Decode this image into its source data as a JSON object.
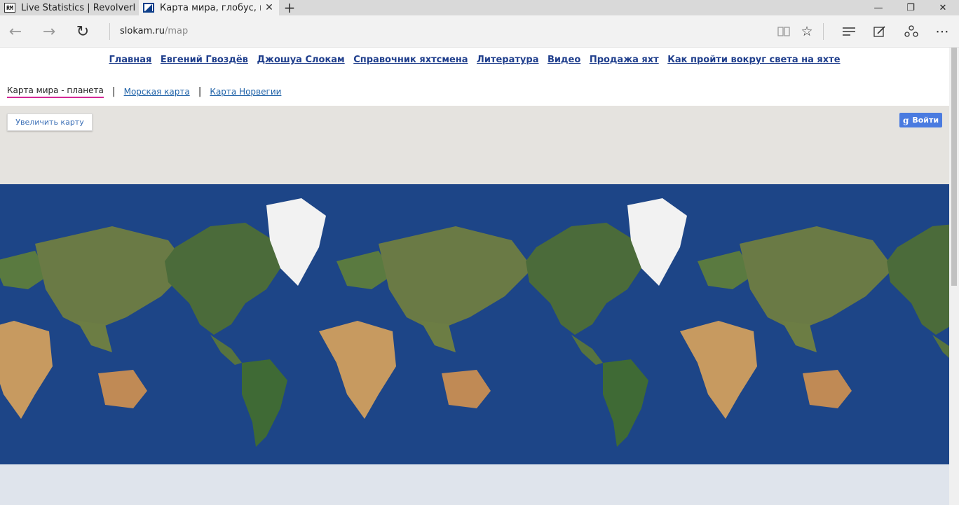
{
  "browser": {
    "tabs": [
      {
        "favicon": "RM",
        "label": "Live Statistics | RevolverMap",
        "active": false
      },
      {
        "favicon": "slokam-icon",
        "label": "Карта мира, глобус, пл",
        "active": true
      }
    ],
    "new_tab": "+",
    "window_controls": {
      "minimize": "—",
      "maximize": "❐",
      "close": "✕"
    },
    "address": {
      "host": "slokam.ru",
      "path": "/map"
    }
  },
  "site": {
    "top_nav": [
      "Главная",
      "Евгений Гвоздёв",
      "Джошуа Слокам",
      "Справочник яхтсмена",
      "Литература",
      "Видео",
      "Продажа яхт",
      "Как пройти вокруг света на яхте"
    ],
    "sub_nav": {
      "current": "Карта мира - планета",
      "links": [
        "Морская карта",
        "Карта Норвегии"
      ],
      "separator": "|"
    },
    "map": {
      "zoom_button": "Увеличить карту",
      "login_button": "Войти",
      "login_icon": "g"
    }
  },
  "colors": {
    "accent_underline": "#d42896",
    "nav_link": "#1f3e8c",
    "login_bg": "#4a7be0"
  }
}
